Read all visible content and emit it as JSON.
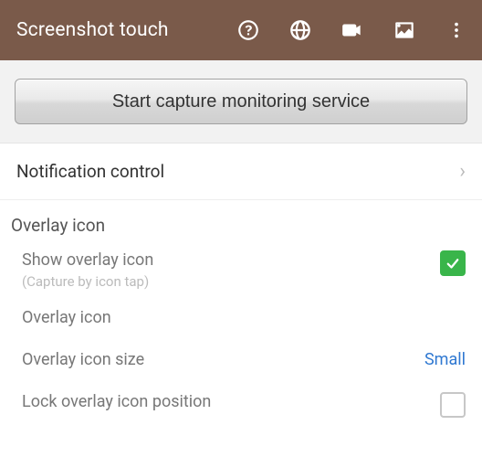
{
  "appbar": {
    "title": "Screenshot touch",
    "icons": {
      "help": "help-circle-icon",
      "globe": "globe-icon",
      "video": "videocam-icon",
      "image": "image-icon",
      "overflow": "more-vert-icon"
    }
  },
  "main": {
    "start_button_label": "Start capture monitoring service",
    "notification_control_label": "Notification control"
  },
  "overlay_section": {
    "header": "Overlay icon",
    "show_overlay": {
      "label": "Show overlay icon",
      "sub": "(Capture by icon tap)",
      "checked": true
    },
    "overlay_icon": {
      "label": "Overlay icon"
    },
    "overlay_icon_size": {
      "label": "Overlay icon size",
      "value": "Small"
    },
    "lock_position": {
      "label": "Lock overlay icon position",
      "checked": false
    }
  }
}
